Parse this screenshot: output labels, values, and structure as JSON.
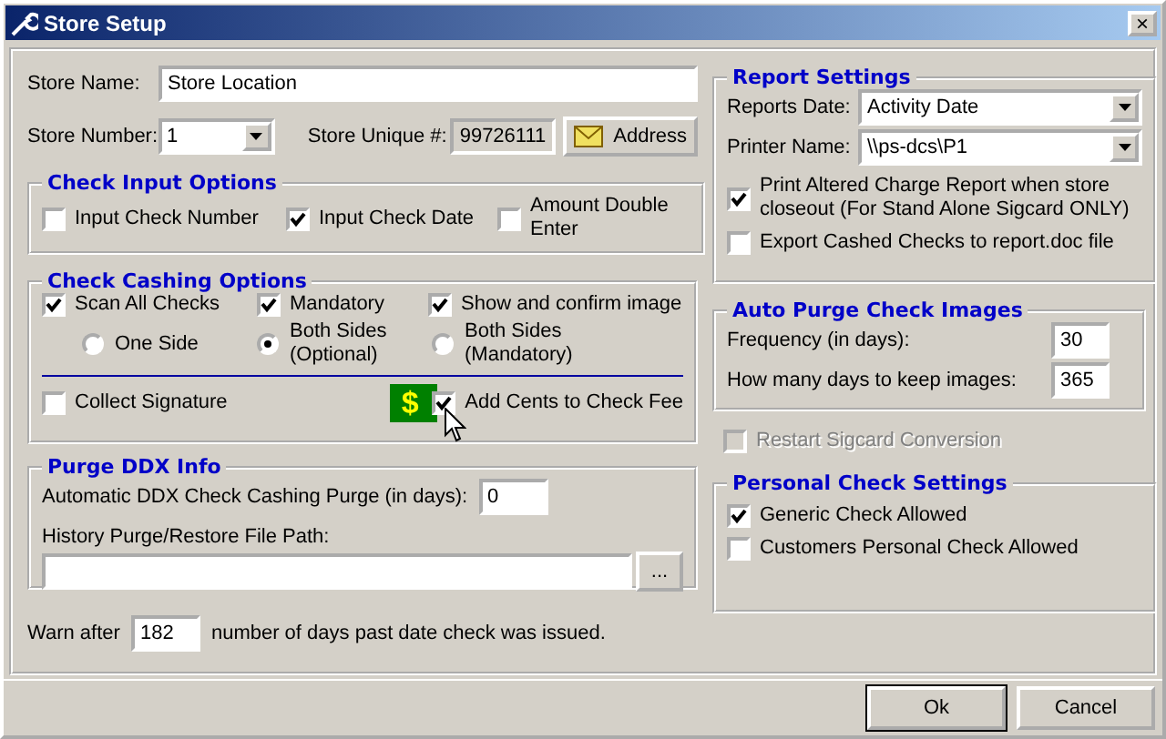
{
  "window": {
    "title": "Store Setup",
    "close": "×"
  },
  "store": {
    "name_label": "Store Name:",
    "name_value": "Store Location",
    "number_label": "Store Number:",
    "number_value": "1",
    "unique_label": "Store Unique #:",
    "unique_value": "99726111",
    "address_button": "Address"
  },
  "check_input": {
    "title": "Check Input Options",
    "options": [
      {
        "label": "Input Check Number",
        "checked": false
      },
      {
        "label": "Input Check Date",
        "checked": true
      },
      {
        "label": "Amount Double Enter",
        "checked": false
      }
    ]
  },
  "check_cashing": {
    "title": "Check Cashing Options",
    "checks": [
      {
        "label": "Scan All Checks",
        "checked": true
      },
      {
        "label": "Mandatory",
        "checked": true
      },
      {
        "label": "Show and confirm image",
        "checked": true
      }
    ],
    "radios": [
      {
        "label": "One Side",
        "selected": false
      },
      {
        "label": "Both Sides (Optional)",
        "selected": true
      },
      {
        "label": "Both Sides (Mandatory)",
        "selected": false
      }
    ],
    "collect_signature": {
      "label": "Collect Signature",
      "checked": false
    },
    "add_cents": {
      "badge": "$",
      "label": "Add Cents to Check Fee",
      "checked": true
    }
  },
  "purge_ddx": {
    "title": "Purge DDX Info",
    "auto_label": "Automatic DDX Check Cashing Purge (in days):",
    "auto_value": "0",
    "path_label": "History Purge/Restore File Path:",
    "browse_button": "..."
  },
  "warn": {
    "before": "Warn after",
    "value": "182",
    "after": "number of days past date check was issued."
  },
  "report_settings": {
    "title": "Report Settings",
    "date_label": "Reports Date:",
    "date_value": "Activity  Date",
    "printer_label": "Printer Name:",
    "printer_value": "\\\\ps-dcs\\P1",
    "options": [
      {
        "label": "Print Altered Charge Report when store closeout (For Stand Alone Sigcard ONLY)",
        "checked": true
      },
      {
        "label": "Export Cashed Checks to report.doc file",
        "checked": false
      }
    ]
  },
  "auto_purge": {
    "title": "Auto Purge Check Images",
    "fields": [
      {
        "label": "Frequency (in days):",
        "value": "30"
      },
      {
        "label": "How many days to keep images:",
        "value": "365"
      }
    ]
  },
  "restart": {
    "label": "Restart Sigcard Conversion",
    "checked": false,
    "disabled": true
  },
  "personal": {
    "title": "Personal Check Settings",
    "options": [
      {
        "label": "Generic Check Allowed",
        "checked": true
      },
      {
        "label": "Customers Personal Check Allowed",
        "checked": false
      }
    ]
  },
  "buttons": [
    {
      "label": "Ok",
      "default": true
    },
    {
      "label": "Cancel",
      "default": false
    }
  ]
}
